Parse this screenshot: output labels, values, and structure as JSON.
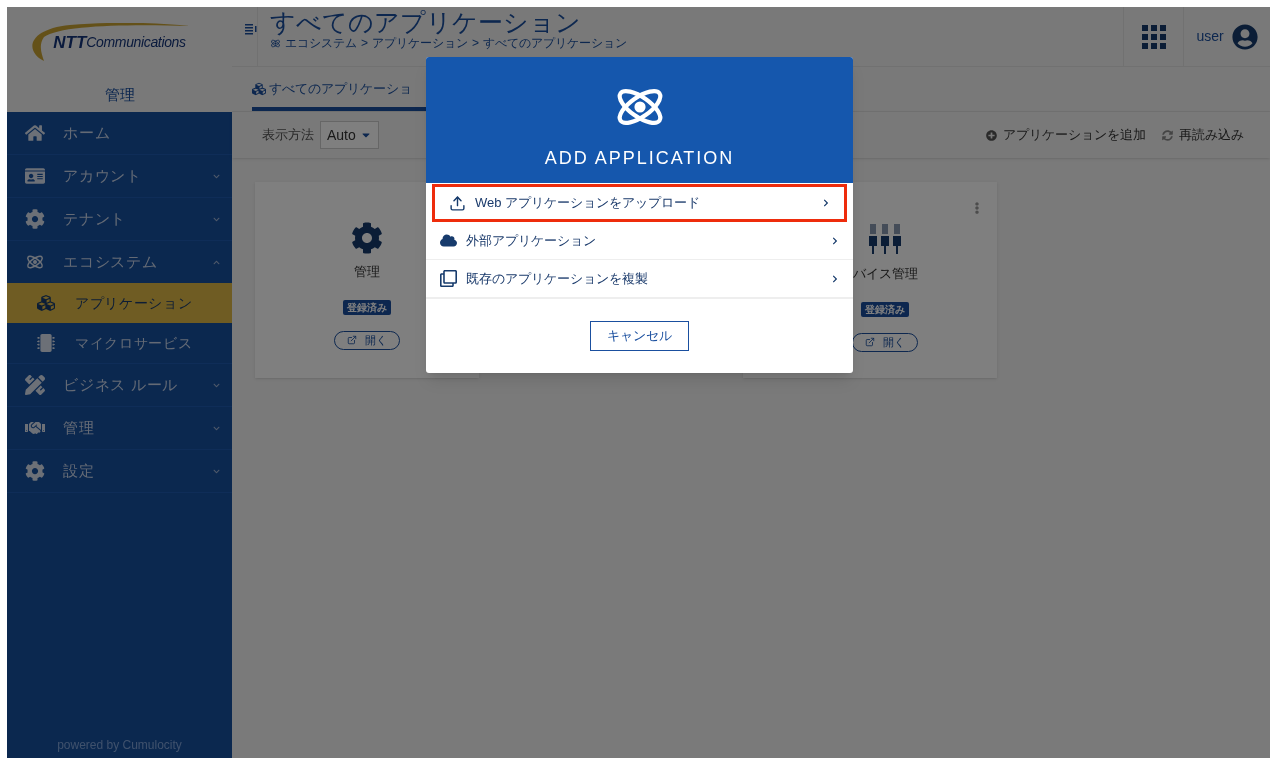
{
  "logo": {
    "brand": "NTT",
    "name": "Communications"
  },
  "sidebar": {
    "title": "管理",
    "items": [
      {
        "label": "ホーム",
        "kind": "link"
      },
      {
        "label": "アカウント",
        "kind": "group",
        "expanded": false
      },
      {
        "label": "テナント",
        "kind": "group",
        "expanded": false
      },
      {
        "label": "エコシステム",
        "kind": "group",
        "expanded": true,
        "children": [
          {
            "label": "アプリケーション",
            "selected": true
          },
          {
            "label": "マイクロサービス",
            "selected": false
          }
        ]
      },
      {
        "label": "ビジネス ルール",
        "kind": "group",
        "expanded": false
      },
      {
        "label": "管理",
        "kind": "group",
        "expanded": false
      },
      {
        "label": "設定",
        "kind": "group",
        "expanded": false
      }
    ],
    "footer": "powered by Cumulocity"
  },
  "header": {
    "title": "すべてのアプリケーション",
    "breadcrumb": [
      "エコシステム",
      ">",
      "アプリケーション",
      ">",
      "すべてのアプリケーション"
    ],
    "user": "user"
  },
  "tabs": [
    {
      "label": "すべてのアプリケーショ",
      "selected": true
    }
  ],
  "toolbar": {
    "view_label": "表示方法",
    "view_value": "Auto",
    "actions": [
      "アプリケーションを追加",
      "再読み込み"
    ]
  },
  "cards": [
    {
      "name": "管理",
      "status": "登録済み",
      "open": "開く"
    },
    {
      "name": "バイス管理",
      "status": "登録済み",
      "open": "開く",
      "menu": true
    }
  ],
  "dialog": {
    "title": "ADD APPLICATION",
    "options": [
      {
        "label": "Web アプリケーションをアップロード",
        "selected": true
      },
      {
        "label": "外部アプリケーション",
        "selected": false
      },
      {
        "label": "既存のアプリケーションを複製",
        "selected": false
      }
    ],
    "cancel": "キャンセル"
  }
}
